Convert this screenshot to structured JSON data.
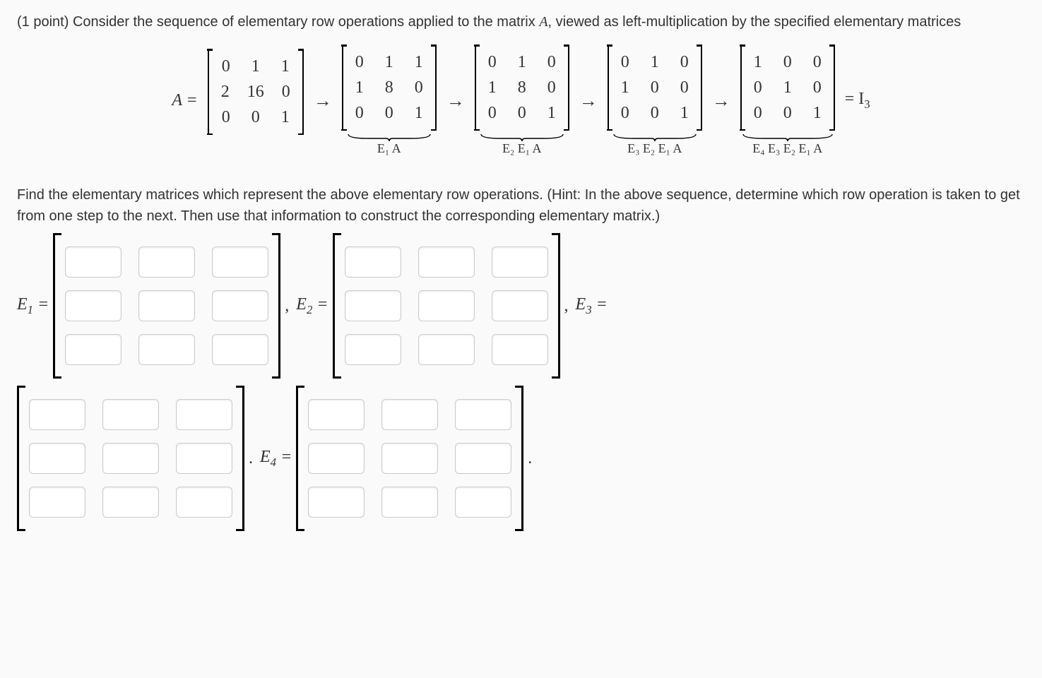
{
  "points_prefix": "(1 point) ",
  "prompt_line1": "Consider the sequence of elementary row operations applied to the matrix ",
  "prompt_A": "A",
  "prompt_line1b": ", viewed as left-multiplication by the specified elementary matrices",
  "equation": {
    "lhs": "A =",
    "rhs_tail": "= I",
    "rhs_sub": "3",
    "arrow": "→",
    "matrices": [
      {
        "rows": [
          [
            "0",
            "1",
            "1"
          ],
          [
            "2",
            "16",
            "0"
          ],
          [
            "0",
            "0",
            "1"
          ]
        ],
        "label": ""
      },
      {
        "rows": [
          [
            "0",
            "1",
            "1"
          ],
          [
            "1",
            "8",
            "0"
          ],
          [
            "0",
            "0",
            "1"
          ]
        ],
        "label": "E₁ A"
      },
      {
        "rows": [
          [
            "0",
            "1",
            "0"
          ],
          [
            "1",
            "8",
            "0"
          ],
          [
            "0",
            "0",
            "1"
          ]
        ],
        "label": "E₂ E₁ A"
      },
      {
        "rows": [
          [
            "0",
            "1",
            "0"
          ],
          [
            "1",
            "0",
            "0"
          ],
          [
            "0",
            "0",
            "1"
          ]
        ],
        "label": "E₃ E₂ E₁ A"
      },
      {
        "rows": [
          [
            "1",
            "0",
            "0"
          ],
          [
            "0",
            "1",
            "0"
          ],
          [
            "0",
            "0",
            "1"
          ]
        ],
        "label": "E₄ E₃ E₂ E₁ A"
      }
    ]
  },
  "prompt2": "Find the elementary matrices which represent the above elementary row operations. (Hint: In the above sequence, determine which row operation is taken to get from one step to the next. Then use that information to construct the corresponding elementary matrix.)",
  "answer_labels": {
    "E1": "E",
    "E1sub": "1",
    "eq": " =",
    "E2": "E",
    "E2sub": "2",
    "E3": "E",
    "E3sub": "3",
    "E4": "E",
    "E4sub": "4",
    "comma": ",",
    "period": "."
  },
  "matrix_inputs": {
    "E1": {
      "rows": 3,
      "cols": 3
    },
    "E2": {
      "rows": 3,
      "cols": 3
    },
    "E3": {
      "rows": 3,
      "cols": 3
    },
    "E4": {
      "rows": 3,
      "cols": 3
    }
  }
}
